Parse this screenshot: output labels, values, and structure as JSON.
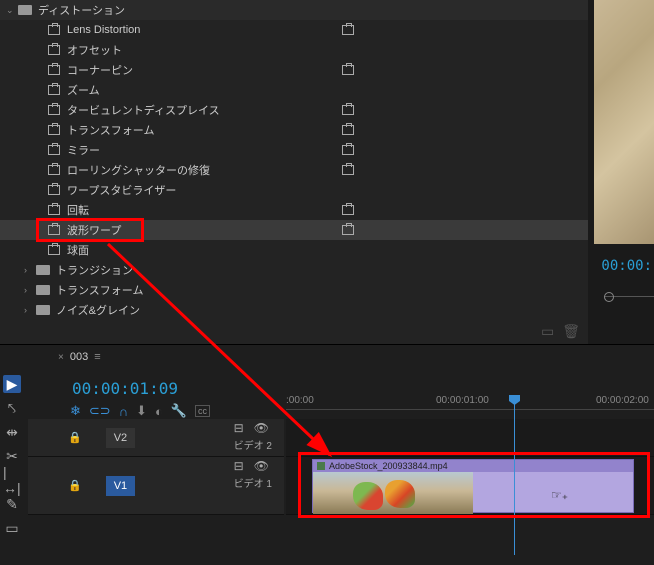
{
  "effects": {
    "folder_root": "ディストーション",
    "items": [
      "Lens Distortion",
      "オフセット",
      "コーナーピン",
      "ズーム",
      "タービュレントディスプレイス",
      "トランスフォーム",
      "ミラー",
      "ローリングシャッターの修復",
      "ワープスタビライザー",
      "回転",
      "波形ワープ",
      "球面"
    ],
    "siblings": [
      "トランジション",
      "トランスフォーム",
      "ノイズ&グレイン"
    ]
  },
  "preview": {
    "timecode": "00:00:"
  },
  "timeline": {
    "sequence": "003",
    "playhead": "00:00:01:09",
    "ruler": [
      ":00:00",
      "00:00:01:00",
      "00:00:02:00"
    ],
    "tracks": {
      "v2": {
        "id": "V2",
        "label": "ビデオ 2"
      },
      "v1": {
        "id": "V1",
        "label": "ビデオ 1"
      }
    },
    "clip": {
      "name": "AdobeStock_200933844.mp4"
    }
  }
}
